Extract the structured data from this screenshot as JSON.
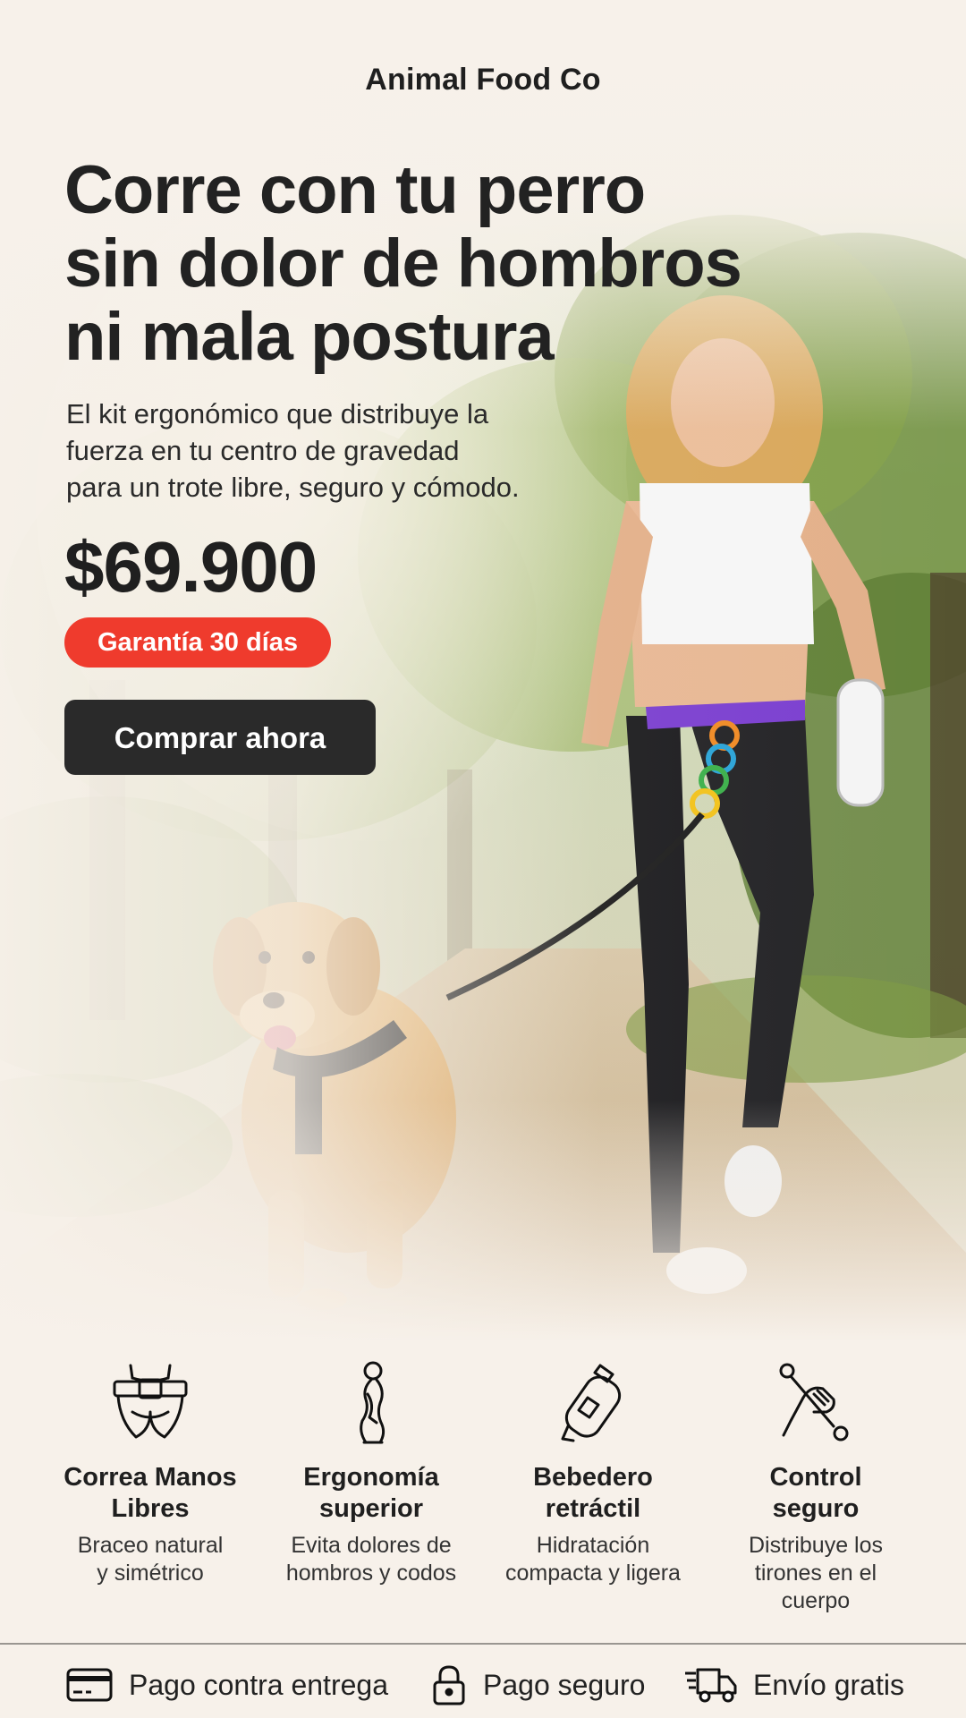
{
  "brand": "Animal Food Co",
  "hero": {
    "headline": [
      "Corre con tu perro",
      "sin dolor de hombros",
      "ni mala postura"
    ],
    "subhead": [
      "El kit ergonómico que distribuye la",
      "fuerza en tu centro de gravedad",
      "para un trote libre, seguro y cómodo."
    ],
    "price": "$69.900",
    "badge": "Garantía 30 días",
    "cta": "Comprar ahora",
    "colors": {
      "badge": "#ef3b2d",
      "cta": "#2a2a2a",
      "background": "#f7f1ea"
    }
  },
  "features": [
    {
      "icon": "hands-free-belt-icon",
      "title": [
        "Correa Manos",
        "Libres"
      ],
      "desc": [
        "Braceo natural",
        "y simétrico"
      ]
    },
    {
      "icon": "posture-body-icon",
      "title": [
        "Ergonomía",
        "superior"
      ],
      "desc": [
        "Evita dolores de",
        "hombros y codos"
      ]
    },
    {
      "icon": "water-bottle-icon",
      "title": [
        "Bebedero",
        "retráctil"
      ],
      "desc": [
        "Hidratación",
        "compacta y ligera"
      ]
    },
    {
      "icon": "hand-wrench-icon",
      "title": [
        "Control",
        "seguro"
      ],
      "desc": [
        "Distribuye los",
        "tirones en el",
        "cuerpo"
      ]
    }
  ],
  "footer": [
    {
      "icon": "credit-card-icon",
      "label": "Pago contra entrega"
    },
    {
      "icon": "padlock-icon",
      "label": "Pago seguro"
    },
    {
      "icon": "delivery-truck-icon",
      "label": "Envío gratis"
    }
  ]
}
